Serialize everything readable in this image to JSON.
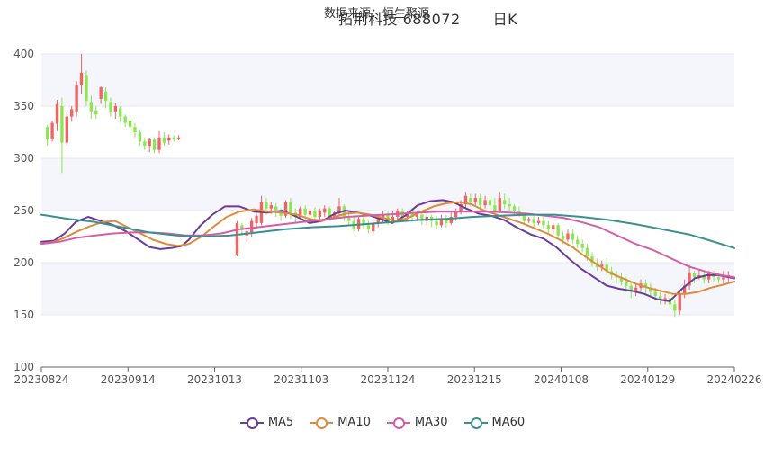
{
  "header": {
    "source": "数据来源：恒生聚源",
    "title": "拓荆科技 688072",
    "period": "日K"
  },
  "chart_data": {
    "type": "candlestick",
    "ylim": [
      100,
      400
    ],
    "yticks": [
      "100",
      "150",
      "200",
      "250",
      "300",
      "350",
      "400"
    ],
    "xticks": [
      "20230824",
      "20230914",
      "20231013",
      "20231103",
      "20231124",
      "20231215",
      "20240108",
      "20240129",
      "20240226"
    ],
    "up_color": "#f06464",
    "down_color": "#8ce650",
    "series_colors": {
      "MA5": "#6a3d9a",
      "MA10": "#e08a3c",
      "MA30": "#d45fa6",
      "MA60": "#3a9090"
    },
    "candles": [
      [
        330,
        318,
        332,
        312
      ],
      [
        318,
        334,
        336,
        316
      ],
      [
        333,
        352,
        356,
        326
      ],
      [
        350,
        315,
        358,
        286
      ],
      [
        315,
        340,
        344,
        312
      ],
      [
        340,
        347,
        350,
        335
      ],
      [
        345,
        370,
        374,
        340
      ],
      [
        370,
        382,
        400,
        362
      ],
      [
        380,
        355,
        384,
        350
      ],
      [
        354,
        345,
        360,
        338
      ],
      [
        346,
        342,
        350,
        338
      ],
      [
        357,
        368,
        369,
        352
      ],
      [
        364,
        355,
        368,
        348
      ],
      [
        354,
        345,
        358,
        340
      ],
      [
        345,
        350,
        353,
        338
      ],
      [
        348,
        340,
        350,
        334
      ],
      [
        340,
        334,
        342,
        330
      ],
      [
        336,
        330,
        338,
        324
      ],
      [
        330,
        325,
        334,
        320
      ],
      [
        325,
        316,
        328,
        312
      ],
      [
        316,
        312,
        320,
        308
      ],
      [
        312,
        318,
        320,
        306
      ],
      [
        318,
        308,
        320,
        305
      ],
      [
        308,
        320,
        326,
        305
      ],
      [
        320,
        315,
        325,
        312
      ],
      [
        317,
        320,
        323,
        313
      ],
      [
        320,
        318,
        322,
        316
      ],
      [
        320,
        320,
        322,
        317
      ],
      [
        null,
        null,
        null,
        null
      ],
      [
        null,
        null,
        null,
        null
      ],
      [
        null,
        null,
        null,
        null
      ],
      [
        null,
        null,
        null,
        null
      ],
      [
        null,
        null,
        null,
        null
      ],
      [
        null,
        null,
        null,
        null
      ],
      [
        null,
        null,
        null,
        null
      ],
      [
        null,
        null,
        null,
        null
      ],
      [
        null,
        null,
        null,
        null
      ],
      [
        null,
        null,
        null,
        null
      ],
      [
        null,
        null,
        null,
        null
      ],
      [
        208,
        238,
        240,
        206
      ],
      [
        236,
        232,
        238,
        226
      ],
      [
        226,
        230,
        233,
        220
      ],
      [
        229,
        240,
        243,
        225
      ],
      [
        238,
        245,
        247,
        233
      ],
      [
        238,
        258,
        264,
        236
      ],
      [
        258,
        252,
        262,
        246
      ],
      [
        252,
        255,
        258,
        247
      ],
      [
        254,
        250,
        257,
        244
      ],
      [
        250,
        245,
        252,
        240
      ],
      [
        245,
        258,
        260,
        243
      ],
      [
        258,
        248,
        262,
        242
      ],
      [
        248,
        244,
        252,
        238
      ],
      [
        244,
        252,
        254,
        242
      ],
      [
        252,
        246,
        255,
        240
      ],
      [
        246,
        250,
        252,
        242
      ],
      [
        250,
        244,
        253,
        238
      ],
      [
        244,
        250,
        252,
        240
      ],
      [
        248,
        252,
        255,
        244
      ],
      [
        252,
        244,
        254,
        240
      ],
      [
        244,
        248,
        250,
        242
      ],
      [
        248,
        254,
        262,
        246
      ],
      [
        254,
        244,
        256,
        240
      ],
      [
        244,
        240,
        248,
        236
      ],
      [
        240,
        232,
        244,
        230
      ],
      [
        232,
        242,
        244,
        230
      ],
      [
        242,
        236,
        246,
        232
      ],
      [
        236,
        232,
        240,
        228
      ],
      [
        230,
        238,
        240,
        228
      ],
      [
        238,
        242,
        245,
        234
      ],
      [
        242,
        246,
        250,
        238
      ],
      [
        246,
        240,
        250,
        236
      ],
      [
        240,
        244,
        250,
        238
      ],
      [
        244,
        250,
        252,
        242
      ],
      [
        250,
        244,
        252,
        240
      ],
      [
        244,
        248,
        250,
        240
      ],
      [
        248,
        244,
        252,
        240
      ],
      [
        244,
        246,
        250,
        240
      ],
      [
        246,
        240,
        248,
        236
      ],
      [
        240,
        244,
        247,
        236
      ],
      [
        244,
        240,
        246,
        234
      ],
      [
        240,
        236,
        245,
        232
      ],
      [
        236,
        242,
        246,
        234
      ],
      [
        242,
        238,
        246,
        234
      ],
      [
        238,
        244,
        248,
        236
      ],
      [
        244,
        250,
        252,
        240
      ],
      [
        250,
        256,
        260,
        246
      ],
      [
        256,
        264,
        268,
        252
      ],
      [
        262,
        258,
        266,
        254
      ],
      [
        258,
        262,
        266,
        254
      ],
      [
        262,
        255,
        266,
        250
      ],
      [
        255,
        260,
        264,
        252
      ],
      [
        260,
        255,
        264,
        250
      ],
      [
        255,
        250,
        262,
        248
      ],
      [
        250,
        262,
        268,
        248
      ],
      [
        260,
        256,
        266,
        252
      ],
      [
        256,
        254,
        262,
        250
      ],
      [
        254,
        250,
        256,
        246
      ],
      [
        250,
        246,
        254,
        244
      ],
      [
        246,
        240,
        248,
        236
      ],
      [
        240,
        242,
        244,
        238
      ],
      [
        242,
        238,
        246,
        234
      ],
      [
        238,
        240,
        244,
        236
      ],
      [
        240,
        236,
        244,
        232
      ],
      [
        236,
        232,
        240,
        228
      ],
      [
        232,
        236,
        238,
        228
      ],
      [
        236,
        226,
        238,
        224
      ],
      [
        226,
        222,
        230,
        218
      ],
      [
        222,
        228,
        232,
        220
      ],
      [
        228,
        222,
        232,
        218
      ],
      [
        222,
        218,
        226,
        214
      ],
      [
        218,
        214,
        222,
        210
      ],
      [
        214,
        206,
        218,
        202
      ],
      [
        206,
        200,
        210,
        196
      ],
      [
        200,
        196,
        204,
        192
      ],
      [
        196,
        198,
        202,
        192
      ],
      [
        198,
        192,
        204,
        188
      ],
      [
        192,
        188,
        196,
        184
      ],
      [
        188,
        186,
        192,
        180
      ],
      [
        186,
        182,
        190,
        178
      ],
      [
        182,
        178,
        186,
        172
      ],
      [
        178,
        172,
        182,
        166
      ],
      [
        172,
        176,
        180,
        168
      ],
      [
        176,
        180,
        184,
        172
      ],
      [
        180,
        176,
        184,
        170
      ],
      [
        176,
        172,
        180,
        168
      ],
      [
        172,
        168,
        176,
        164
      ],
      [
        168,
        164,
        172,
        160
      ],
      [
        164,
        166,
        170,
        160
      ],
      [
        166,
        160,
        170,
        156
      ],
      [
        160,
        154,
        164,
        148
      ],
      [
        154,
        170,
        172,
        150
      ],
      [
        170,
        178,
        184,
        166
      ],
      [
        178,
        190,
        198,
        174
      ],
      [
        190,
        186,
        192,
        180
      ],
      [
        186,
        188,
        194,
        184
      ],
      [
        188,
        184,
        192,
        180
      ],
      [
        184,
        190,
        192,
        180
      ],
      [
        190,
        186,
        192,
        182
      ],
      [
        186,
        184,
        190,
        180
      ],
      [
        184,
        186,
        192,
        180
      ],
      [
        186,
        188,
        192,
        182
      ]
    ],
    "ma": {
      "MA5": [
        [
          0,
          220
        ],
        [
          14,
          221
        ],
        [
          26,
          228
        ],
        [
          38,
          239
        ],
        [
          52,
          244
        ],
        [
          66,
          240
        ],
        [
          80,
          236
        ],
        [
          94,
          230
        ],
        [
          108,
          222
        ],
        [
          120,
          215
        ],
        [
          132,
          213
        ],
        [
          144,
          214
        ],
        [
          156,
          216
        ],
        [
          164,
          222
        ],
        [
          176,
          235
        ],
        [
          190,
          246
        ],
        [
          204,
          254
        ],
        [
          220,
          254
        ],
        [
          236,
          249
        ],
        [
          252,
          248
        ],
        [
          268,
          250
        ],
        [
          284,
          244
        ],
        [
          298,
          238
        ],
        [
          312,
          240
        ],
        [
          326,
          247
        ],
        [
          338,
          250
        ],
        [
          352,
          248
        ],
        [
          366,
          245
        ],
        [
          380,
          241
        ],
        [
          390,
          238
        ],
        [
          404,
          245
        ],
        [
          418,
          255
        ],
        [
          432,
          259
        ],
        [
          446,
          260
        ],
        [
          458,
          258
        ],
        [
          472,
          252
        ],
        [
          486,
          247
        ],
        [
          500,
          245
        ],
        [
          514,
          241
        ],
        [
          530,
          233
        ],
        [
          544,
          227
        ],
        [
          558,
          223
        ],
        [
          572,
          215
        ],
        [
          586,
          204
        ],
        [
          600,
          194
        ],
        [
          614,
          186
        ],
        [
          628,
          178
        ],
        [
          642,
          175
        ],
        [
          656,
          173
        ],
        [
          670,
          170
        ],
        [
          684,
          165
        ],
        [
          698,
          163
        ],
        [
          712,
          175
        ],
        [
          726,
          185
        ],
        [
          740,
          188
        ],
        [
          752,
          188
        ],
        [
          770,
          185
        ]
      ],
      "MA10": [
        [
          0,
          218
        ],
        [
          14,
          220
        ],
        [
          26,
          224
        ],
        [
          40,
          230
        ],
        [
          54,
          235
        ],
        [
          68,
          239
        ],
        [
          82,
          240
        ],
        [
          96,
          234
        ],
        [
          110,
          228
        ],
        [
          124,
          222
        ],
        [
          138,
          218
        ],
        [
          152,
          216
        ],
        [
          164,
          218
        ],
        [
          178,
          225
        ],
        [
          192,
          235
        ],
        [
          206,
          244
        ],
        [
          220,
          249
        ],
        [
          236,
          251
        ],
        [
          252,
          249
        ],
        [
          268,
          248
        ],
        [
          284,
          246
        ],
        [
          298,
          242
        ],
        [
          312,
          240
        ],
        [
          326,
          244
        ],
        [
          338,
          247
        ],
        [
          352,
          248
        ],
        [
          366,
          246
        ],
        [
          380,
          243
        ],
        [
          394,
          240
        ],
        [
          408,
          243
        ],
        [
          422,
          249
        ],
        [
          436,
          254
        ],
        [
          450,
          257
        ],
        [
          464,
          258
        ],
        [
          478,
          256
        ],
        [
          492,
          250
        ],
        [
          506,
          246
        ],
        [
          520,
          242
        ],
        [
          534,
          238
        ],
        [
          548,
          233
        ],
        [
          562,
          228
        ],
        [
          576,
          222
        ],
        [
          590,
          215
        ],
        [
          604,
          206
        ],
        [
          618,
          198
        ],
        [
          632,
          190
        ],
        [
          646,
          185
        ],
        [
          660,
          180
        ],
        [
          674,
          176
        ],
        [
          688,
          173
        ],
        [
          702,
          170
        ],
        [
          716,
          170
        ],
        [
          730,
          172
        ],
        [
          744,
          176
        ],
        [
          758,
          179
        ],
        [
          770,
          182
        ]
      ],
      "MA30": [
        [
          0,
          218
        ],
        [
          20,
          220
        ],
        [
          40,
          224
        ],
        [
          60,
          226
        ],
        [
          80,
          228
        ],
        [
          100,
          229
        ],
        [
          120,
          229
        ],
        [
          140,
          228
        ],
        [
          160,
          226
        ],
        [
          180,
          226
        ],
        [
          200,
          228
        ],
        [
          220,
          232
        ],
        [
          240,
          234
        ],
        [
          260,
          236
        ],
        [
          280,
          238
        ],
        [
          300,
          240
        ],
        [
          320,
          242
        ],
        [
          340,
          244
        ],
        [
          360,
          245
        ],
        [
          380,
          246
        ],
        [
          400,
          247
        ],
        [
          420,
          248
        ],
        [
          440,
          249
        ],
        [
          460,
          249
        ],
        [
          480,
          249
        ],
        [
          500,
          249
        ],
        [
          520,
          248
        ],
        [
          540,
          247
        ],
        [
          560,
          245
        ],
        [
          580,
          243
        ],
        [
          600,
          239
        ],
        [
          620,
          234
        ],
        [
          640,
          226
        ],
        [
          660,
          218
        ],
        [
          680,
          212
        ],
        [
          700,
          204
        ],
        [
          720,
          196
        ],
        [
          740,
          191
        ],
        [
          755,
          188
        ],
        [
          770,
          186
        ]
      ],
      "MA60": [
        [
          0,
          246
        ],
        [
          30,
          242
        ],
        [
          60,
          239
        ],
        [
          90,
          234
        ],
        [
          120,
          229
        ],
        [
          150,
          226
        ],
        [
          180,
          225
        ],
        [
          210,
          226
        ],
        [
          240,
          229
        ],
        [
          270,
          232
        ],
        [
          300,
          234
        ],
        [
          330,
          235
        ],
        [
          360,
          237
        ],
        [
          390,
          239
        ],
        [
          420,
          241
        ],
        [
          450,
          242
        ],
        [
          480,
          244
        ],
        [
          510,
          245
        ],
        [
          540,
          246
        ],
        [
          570,
          246
        ],
        [
          600,
          244
        ],
        [
          630,
          241
        ],
        [
          660,
          237
        ],
        [
          690,
          232
        ],
        [
          720,
          227
        ],
        [
          740,
          222
        ],
        [
          770,
          214
        ]
      ]
    }
  },
  "legend": {
    "items": [
      {
        "label": "MA5",
        "color": "#6a3d9a"
      },
      {
        "label": "MA10",
        "color": "#e08a3c"
      },
      {
        "label": "MA30",
        "color": "#d45fa6"
      },
      {
        "label": "MA60",
        "color": "#3a9090"
      }
    ]
  }
}
